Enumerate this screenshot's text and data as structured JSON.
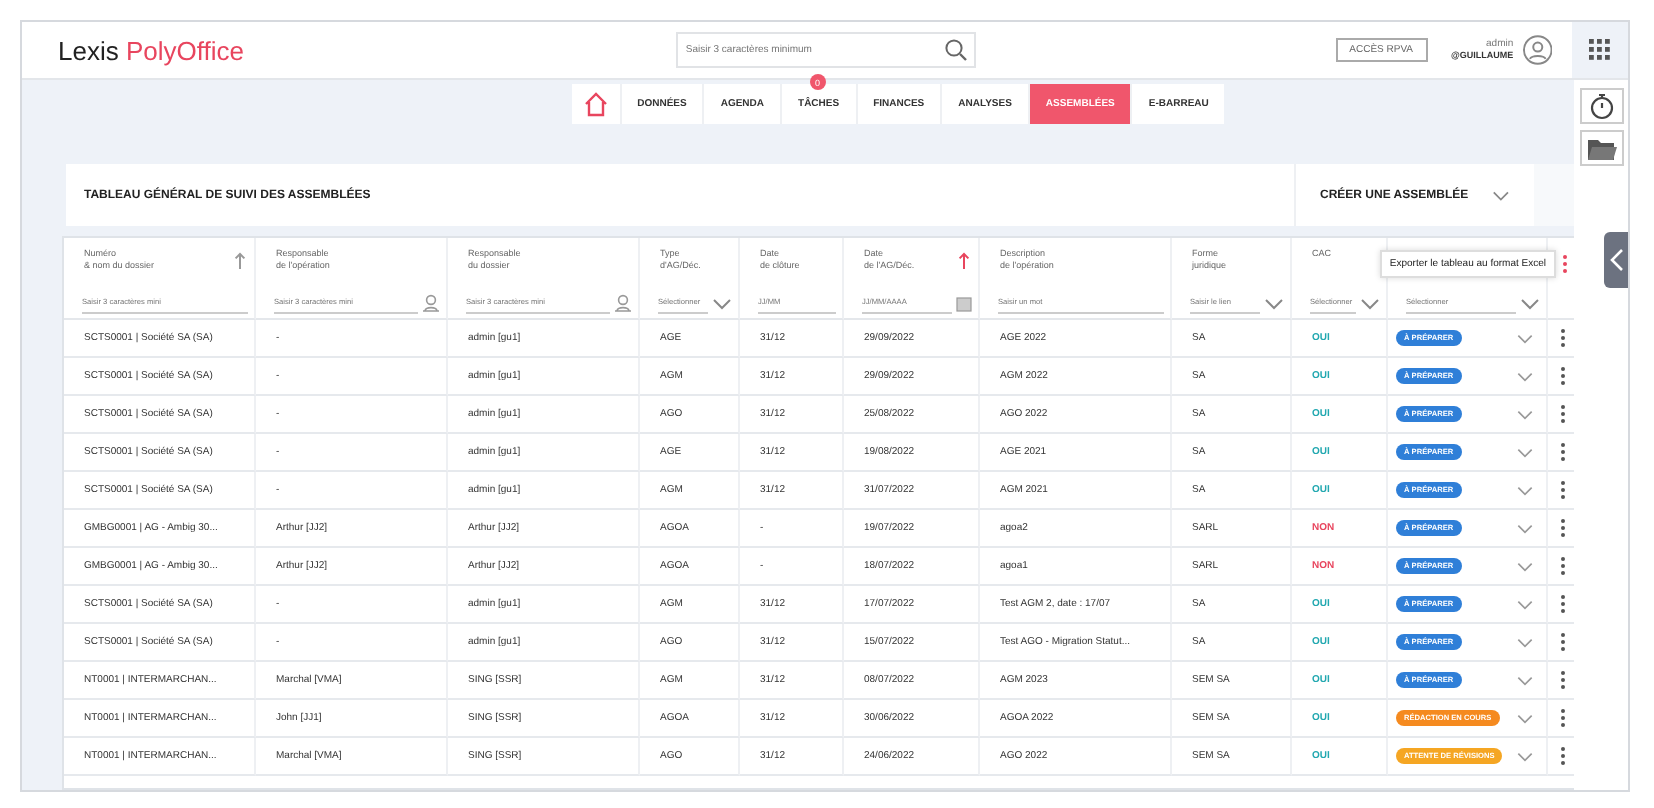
{
  "header": {
    "logo_left": "Lexis",
    "logo_right": "PolyOffice",
    "search": {
      "placeholder": "Saisir 3 caractères minimum"
    },
    "access_button": "ACCÈS RPVA",
    "user_name": "admin",
    "user_handle": "@GUILLAUME"
  },
  "nav": [
    {
      "label": "DONNÉES",
      "selected": false
    },
    {
      "label": "AGENDA",
      "selected": false
    },
    {
      "label": "TÂCHES",
      "selected": false,
      "badge": "0"
    },
    {
      "label": "FINANCES",
      "selected": false
    },
    {
      "label": "ANALYSES",
      "selected": false
    },
    {
      "label": "ASSEMBLÉES",
      "selected": true
    },
    {
      "label": "E-BARREAU",
      "selected": false
    }
  ],
  "title": "TABLEAU GÉNÉRAL DE SUIVI DES ASSEMBLÉES",
  "create_menu": "CRÉER UNE ASSEMBLÉE",
  "table": {
    "columns": [
      {
        "label": "Numéro\n& nom du dossier",
        "sort_active": false,
        "filter": {
          "kind": "text",
          "placeholder": "Saisir 3 caractères mini"
        }
      },
      {
        "label": "Responsable\nde l'opération",
        "filter": {
          "kind": "person",
          "placeholder": "Saisir 3 caractères mini"
        }
      },
      {
        "label": "Responsable\ndu dossier",
        "filter": {
          "kind": "person",
          "placeholder": "Saisir 3 caractères mini"
        }
      },
      {
        "label": "Type\nd'AG/Déc.",
        "filter": {
          "kind": "select",
          "placeholder": "Sélectionner"
        }
      },
      {
        "label": "Date\nde clôture",
        "filter": {
          "kind": "text",
          "placeholder": "JJ/MM"
        }
      },
      {
        "label": "Date\nde l'AG/Déc.",
        "sort_active": true,
        "filter": {
          "kind": "date",
          "placeholder": "JJ/MM/AAAA"
        }
      },
      {
        "label": "Description\nde l'opération",
        "filter": {
          "kind": "text",
          "placeholder": "Saisir un mot"
        }
      },
      {
        "label": "Forme\njuridique",
        "filter": {
          "kind": "select",
          "placeholder": "Saisir le lien"
        }
      },
      {
        "label": "CAC",
        "filter": {
          "kind": "select",
          "placeholder": "Sélectionner"
        }
      },
      {
        "filter": {
          "kind": "select",
          "placeholder": "Sélectionner"
        }
      }
    ],
    "tooltip": "Exporter le tableau au format Excel",
    "rows": [
      {
        "cells": [
          "SCTS0001 | Société SA (SA)",
          "-",
          "admin [gu1]",
          "AGE",
          "31/12",
          "29/09/2022",
          "AGE 2022",
          "SA"
        ],
        "cac": {
          "text": "OUI",
          "color": "#22a8b0"
        },
        "status": {
          "text": "À PRÉPARER",
          "color": "#2f7fd8"
        }
      },
      {
        "cells": [
          "SCTS0001 | Société SA (SA)",
          "-",
          "admin [gu1]",
          "AGM",
          "31/12",
          "29/09/2022",
          "AGM 2022",
          "SA"
        ],
        "cac": {
          "text": "OUI",
          "color": "#22a8b0"
        },
        "status": {
          "text": "À PRÉPARER",
          "color": "#2f7fd8"
        }
      },
      {
        "cells": [
          "SCTS0001 | Société SA (SA)",
          "-",
          "admin [gu1]",
          "AGO",
          "31/12",
          "25/08/2022",
          "AGO 2022",
          "SA"
        ],
        "cac": {
          "text": "OUI",
          "color": "#22a8b0"
        },
        "status": {
          "text": "À PRÉPARER",
          "color": "#2f7fd8"
        }
      },
      {
        "cells": [
          "SCTS0001 | Société SA (SA)",
          "-",
          "admin [gu1]",
          "AGE",
          "31/12",
          "19/08/2022",
          "AGE 2021",
          "SA"
        ],
        "cac": {
          "text": "OUI",
          "color": "#22a8b0"
        },
        "status": {
          "text": "À PRÉPARER",
          "color": "#2f7fd8"
        }
      },
      {
        "cells": [
          "SCTS0001 | Société SA (SA)",
          "-",
          "admin [gu1]",
          "AGM",
          "31/12",
          "31/07/2022",
          "AGM 2021",
          "SA"
        ],
        "cac": {
          "text": "OUI",
          "color": "#22a8b0"
        },
        "status": {
          "text": "À PRÉPARER",
          "color": "#2f7fd8"
        }
      },
      {
        "cells": [
          "GMBG0001 | AG - Ambig 30...",
          "Arthur [JJ2]",
          "Arthur [JJ2]",
          "AGOA",
          "-",
          "19/07/2022",
          "agoa2",
          "SARL"
        ],
        "cac": {
          "text": "NON",
          "color": "#e8455e"
        },
        "status": {
          "text": "À PRÉPARER",
          "color": "#2f7fd8"
        }
      },
      {
        "cells": [
          "GMBG0001 | AG - Ambig 30...",
          "Arthur [JJ2]",
          "Arthur [JJ2]",
          "AGOA",
          "-",
          "18/07/2022",
          "agoa1",
          "SARL"
        ],
        "cac": {
          "text": "NON",
          "color": "#e8455e"
        },
        "status": {
          "text": "À PRÉPARER",
          "color": "#2f7fd8"
        }
      },
      {
        "cells": [
          "SCTS0001 | Société SA (SA)",
          "-",
          "admin [gu1]",
          "AGM",
          "31/12",
          "17/07/2022",
          "Test AGM 2, date : 17/07",
          "SA"
        ],
        "cac": {
          "text": "OUI",
          "color": "#22a8b0"
        },
        "status": {
          "text": "À PRÉPARER",
          "color": "#2f7fd8"
        }
      },
      {
        "cells": [
          "SCTS0001 | Société SA (SA)",
          "-",
          "admin [gu1]",
          "AGO",
          "31/12",
          "15/07/2022",
          "Test AGO - Migration Statut...",
          "SA"
        ],
        "cac": {
          "text": "OUI",
          "color": "#22a8b0"
        },
        "status": {
          "text": "À PRÉPARER",
          "color": "#2f7fd8"
        }
      },
      {
        "cells": [
          "NT0001 | INTERMARCHAN...",
          "Marchal [VMA]",
          "SING [SSR]",
          "AGM",
          "31/12",
          "08/07/2022",
          "AGM 2023",
          "SEM SA"
        ],
        "cac": {
          "text": "OUI",
          "color": "#22a8b0"
        },
        "status": {
          "text": "À PRÉPARER",
          "color": "#2f7fd8"
        }
      },
      {
        "cells": [
          "NT0001 | INTERMARCHAN...",
          "John [JJ1]",
          "SING [SSR]",
          "AGOA",
          "31/12",
          "30/06/2022",
          "AGOA 2022",
          "SEM SA"
        ],
        "cac": {
          "text": "OUI",
          "color": "#22a8b0"
        },
        "status": {
          "text": "RÉDACTION EN COURS",
          "color": "#f58a1f"
        }
      },
      {
        "cells": [
          "NT0001 | INTERMARCHAN...",
          "Marchal [VMA]",
          "SING [SSR]",
          "AGO",
          "31/12",
          "24/06/2022",
          "AGO 2022",
          "SEM SA"
        ],
        "cac": {
          "text": "OUI",
          "color": "#22a8b0"
        },
        "status": {
          "text": "ATTENTE DE RÉVISIONS",
          "color": "#f5a623"
        }
      }
    ]
  }
}
